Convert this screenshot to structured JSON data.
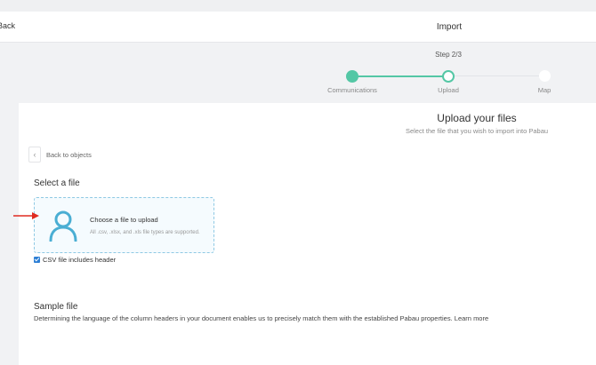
{
  "header": {
    "back_label": "Back",
    "title": "Import"
  },
  "stepper": {
    "step_count": "Step 2/3",
    "steps": [
      {
        "label": "Communications",
        "state": "done"
      },
      {
        "label": "Upload",
        "state": "current"
      },
      {
        "label": "Map",
        "state": "todo"
      }
    ],
    "accent_color": "#54c7a5"
  },
  "main": {
    "title": "Upload your files",
    "subtitle": "Select the file that you wish to import into Pabau",
    "back_to_objects": "Back to objects",
    "select_file_title": "Select a file",
    "dropzone": {
      "icon": "person-icon",
      "title": "Choose a file to upload",
      "subtitle": "All .csv, .xlsx, and .xls file types are supported."
    },
    "csv_header_checkbox": {
      "label": "CSV file includes header",
      "checked": true
    },
    "sample": {
      "title": "Sample file",
      "description": "Determining the language of the column headers in your document enables us to precisely match them with the established Pabau properties.",
      "learn_more": "Learn more"
    }
  },
  "annotation_arrow_color": "#e02b20"
}
